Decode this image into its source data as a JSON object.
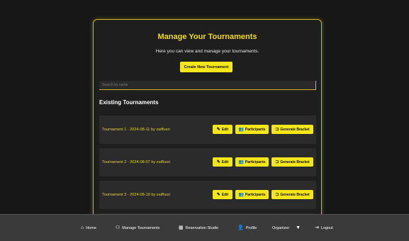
{
  "panel": {
    "title": "Manage Your Tournaments",
    "subtitle": "Here you can view and manage your tournaments.",
    "create_button": "Create New Tournament",
    "search_placeholder": "Search by name",
    "section_title": "Existing Tournaments"
  },
  "tournaments": [
    {
      "label": "Tournament 1 - 2024-08-11 by zaiffusri"
    },
    {
      "label": "Tournament 2 - 2024-08-07 by zaiffusri"
    },
    {
      "label": "Tournament 3 - 2024-08-19 by zaiffusri"
    }
  ],
  "actions": {
    "edit": "Edit",
    "participants": "Participants",
    "generate": "Generate Bracket"
  },
  "nav": {
    "home": "Home",
    "manage": "Manage Tournaments",
    "reservation": "Reservation Studio",
    "profile": "Profile",
    "organizer": "Organizer",
    "logout": "Logout"
  },
  "colors": {
    "accent": "#f5e619",
    "panel_border": "#c9b81f",
    "background": "#171717",
    "navbar": "#3a3a3a"
  }
}
